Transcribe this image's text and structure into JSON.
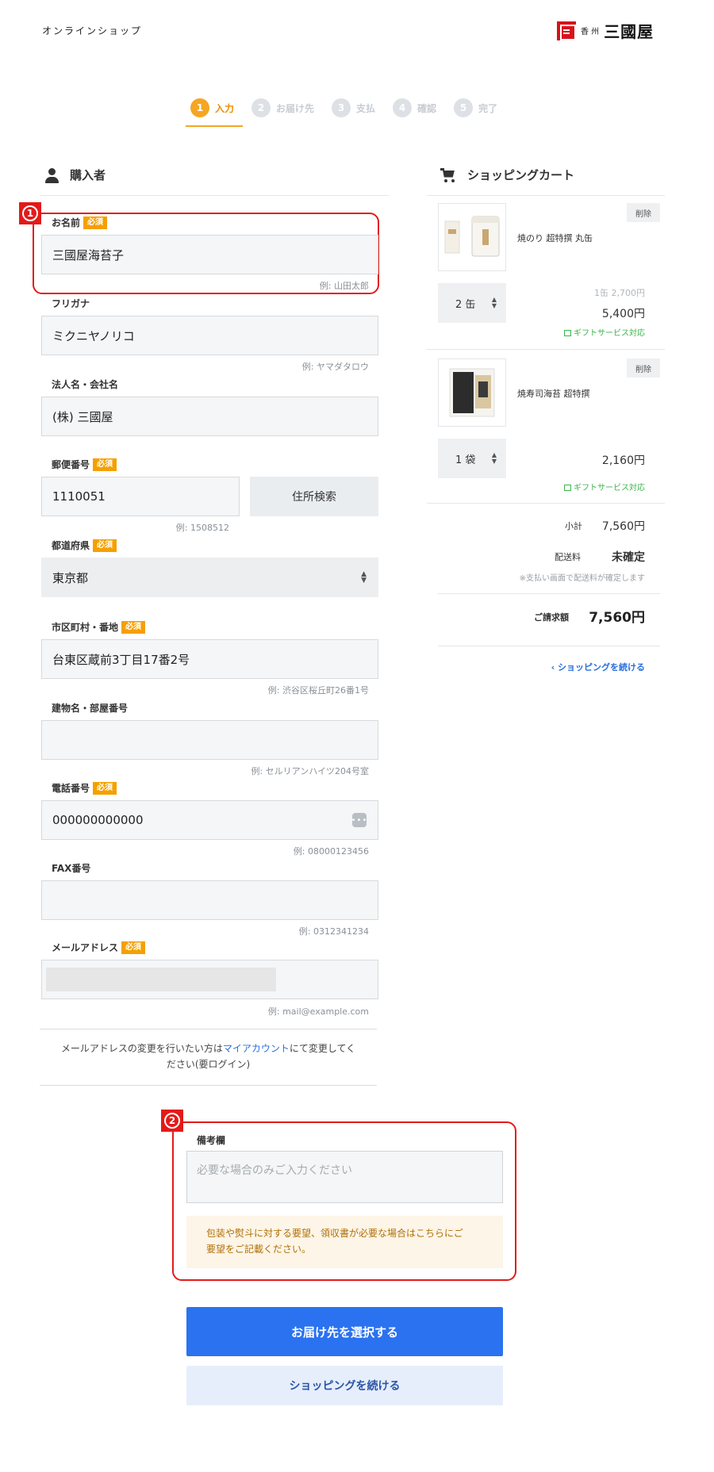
{
  "header": {
    "shop_title": "オンラインショップ",
    "logo_sub": "香 州",
    "logo_main": "三國屋"
  },
  "steps": [
    {
      "num": "1",
      "label": "入力"
    },
    {
      "num": "2",
      "label": "お届け先"
    },
    {
      "num": "3",
      "label": "支払"
    },
    {
      "num": "4",
      "label": "確認"
    },
    {
      "num": "5",
      "label": "完了"
    }
  ],
  "buyer": {
    "section_title": "購入者",
    "required_badge": "必須",
    "name": {
      "label": "お名前",
      "value": "三國屋海苔子",
      "hint": "例: 山田太郎"
    },
    "kana": {
      "label": "フリガナ",
      "value": "ミクニヤノリコ",
      "hint": "例: ヤマダタロウ"
    },
    "company": {
      "label": "法人名・会社名",
      "value": "(株) 三國屋"
    },
    "postal": {
      "label": "郵便番号",
      "value": "1110051",
      "hint": "例: 1508512",
      "search_button": "住所検索"
    },
    "prefecture": {
      "label": "都道府県",
      "value": "東京都"
    },
    "city": {
      "label": "市区町村・番地",
      "value": "台東区蔵前3丁目17番2号",
      "hint": "例: 渋谷区桜丘町26番1号"
    },
    "building": {
      "label": "建物名・部屋番号",
      "value": "",
      "hint": "例: セルリアンハイツ204号室"
    },
    "phone": {
      "label": "電話番号",
      "value": "000000000000",
      "hint": "例: 08000123456"
    },
    "fax": {
      "label": "FAX番号",
      "value": "",
      "hint": "例: 0312341234"
    },
    "email": {
      "label": "メールアドレス",
      "value": "",
      "hint": "例: mail@example.com"
    },
    "email_note_before": "メールアドレスの変更を行いたい方は",
    "email_note_link": "マイアカウント",
    "email_note_after": "にて変更してく",
    "email_note_line2": "ださい(要ログイン)"
  },
  "remarks": {
    "label": "備考欄",
    "placeholder": "必要な場合のみご入力ください",
    "notice_line1": "包装や熨斗に対する要望、領収書が必要な場合はこちらにご",
    "notice_line2": "要望をご記載ください。"
  },
  "annotations": {
    "badge1": "1",
    "badge2": "2"
  },
  "buttons": {
    "primary": "お届け先を選択する",
    "secondary": "ショッピングを続ける"
  },
  "cart": {
    "title": "ショッピングカート",
    "delete_label": "削除",
    "gift_label": "ギフトサービス対応",
    "items": [
      {
        "name": "焼のり 超特撰 丸缶",
        "qty": "2 缶",
        "unit_price": "1缶 2,700円",
        "price": "5,400円"
      },
      {
        "name": "焼寿司海苔 超特撰",
        "qty": "1 袋",
        "unit_price": "",
        "price": "2,160円"
      }
    ],
    "subtotal_label": "小計",
    "subtotal_value": "7,560円",
    "shipping_label": "配送料",
    "shipping_value": "未確定",
    "shipping_note": "※支払い画面で配送料が確定します",
    "total_label": "ご請求額",
    "total_value": "7,560円",
    "continue_link": "ショッピングを続ける"
  }
}
